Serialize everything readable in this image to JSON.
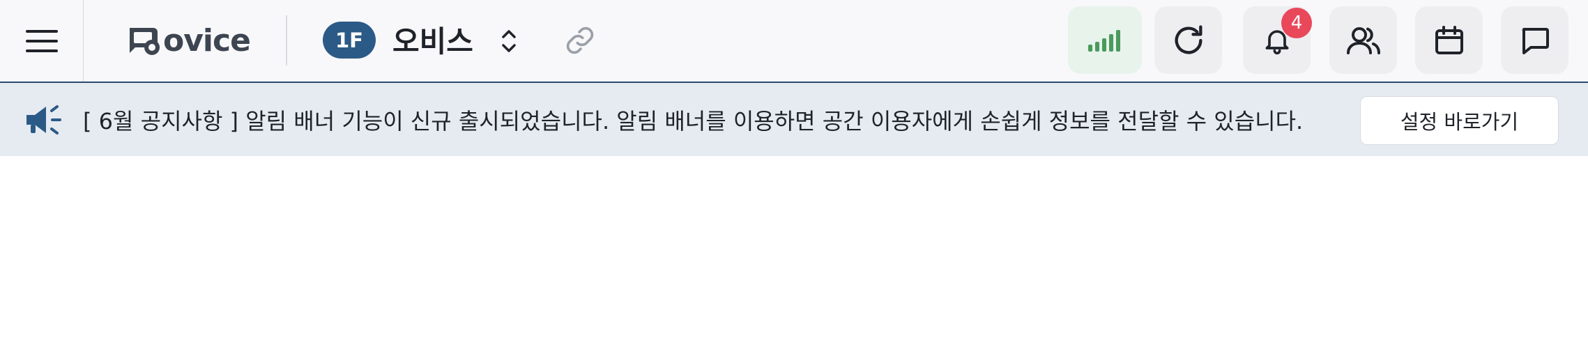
{
  "header": {
    "logo_text": "ovice",
    "floor_badge": "1F",
    "space_name": "오비스",
    "notification_count": "4",
    "icons": {
      "menu": "hamburger-menu-icon",
      "switch": "chevron-up-down-icon",
      "link": "link-icon",
      "signal": "signal-strength-icon",
      "reload": "reload-icon",
      "bell": "bell-icon",
      "members": "members-icon",
      "calendar": "calendar-icon",
      "chat": "chat-icon"
    },
    "colors": {
      "brand_dark": "#2c5a87",
      "signal_green": "#4a9a5c",
      "badge_red": "#e8485a"
    }
  },
  "banner": {
    "icon": "megaphone-icon",
    "message": "[ 6월 공지사항 ] 알림 배너 기능이 신규 출시되었습니다. 알림 배너를 이용하면 공간 이용자에게 손쉽게 정보를 전달할 수 있습니다.",
    "button_label": "설정 바로가기"
  }
}
